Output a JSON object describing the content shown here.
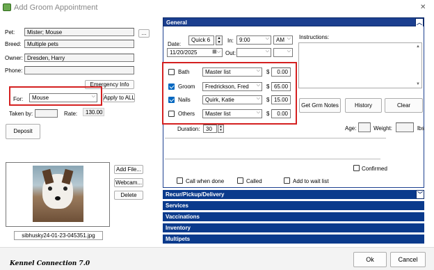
{
  "window": {
    "title": "Add Groom Appointment",
    "close": "✕"
  },
  "pet_info": {
    "pet_label": "Pet:",
    "pet_value": "Mister; Mouse",
    "pet_lookup": "...",
    "breed_label": "Breed:",
    "breed_value": "Multiple pets",
    "owner_label": "Owner:",
    "owner_value": "Dresden, Harry",
    "phone_label": "Phone:",
    "phone_value": ""
  },
  "emergency_info": "Emergency Info",
  "for_label": "For:",
  "for_value": "Mouse",
  "apply_all": "Apply to ALL",
  "taken_by_label": "Taken by:",
  "taken_by_value": "",
  "rate_label": "Rate:",
  "rate_value": "130.00",
  "deposit": "Deposit",
  "photo_buttons": {
    "add_file": "Add File...",
    "webcam": "Webcam...",
    "delete": "Delete"
  },
  "photo_filename": "sibhusky24-01-23-045351.jpg",
  "general": {
    "title": "General",
    "date_label": "Date:",
    "quick": "Quick 6",
    "in_label": "In:",
    "in_time": "9:00",
    "in_ampm": "AM",
    "date_value": "11/20/2025",
    "out_label": "Out:",
    "out_time": "",
    "out_ampm": "",
    "instructions_label": "Instructions:",
    "services": [
      {
        "name": "Bath",
        "checked": false,
        "groomer": "Master list",
        "price": "0.00"
      },
      {
        "name": "Groom",
        "checked": true,
        "groomer": "Fredrickson, Fred",
        "price": "65.00"
      },
      {
        "name": "Nails",
        "checked": true,
        "groomer": "Quirk, Katie",
        "price": "15.00"
      },
      {
        "name": "Others",
        "checked": false,
        "groomer": "Master list",
        "price": "0.00"
      }
    ],
    "currency": "$",
    "get_grm_notes": "Get Grm Notes",
    "history": "History",
    "clear": "Clear",
    "duration_label": "Duration:",
    "duration_value": "30",
    "age_label": "Age:",
    "weight_label": "Weight:",
    "weight_unit": "lbs",
    "confirmed": "Confirmed",
    "call_when_done": "Call when done",
    "called": "Called",
    "add_to_wait_list": "Add to wait list"
  },
  "sections": [
    "Recur/Pickup/Delivery",
    "Services",
    "Vaccinations",
    "Inventory",
    "Multipets"
  ],
  "footer": {
    "brand": "Kennel Connection 7.0",
    "ok": "Ok",
    "cancel": "Cancel"
  },
  "colors": {
    "section_header": "#0a3a8c",
    "highlight": "#d42020",
    "check_accent": "#0067c0"
  }
}
